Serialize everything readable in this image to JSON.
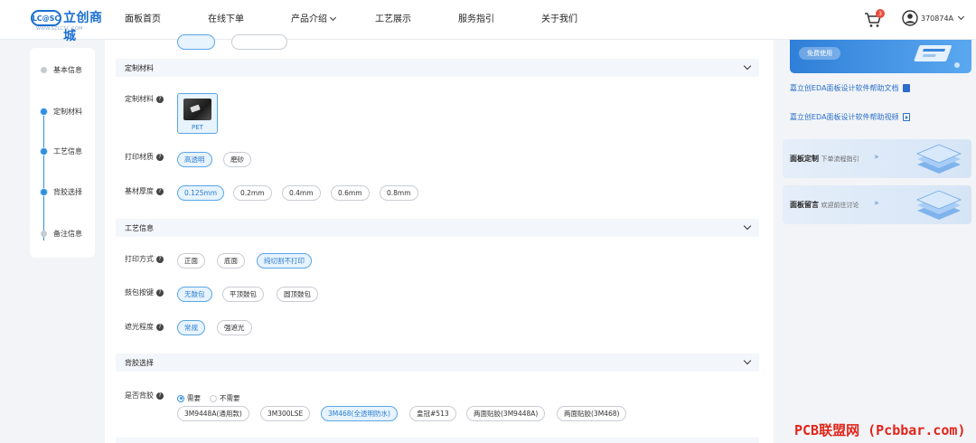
{
  "brand": {
    "badge": "LC@SC",
    "name": "立创商城",
    "url": "WWW.SZLCSC.COM"
  },
  "nav": [
    {
      "label": "面板首页"
    },
    {
      "label": "在线下单"
    },
    {
      "label": "产品介绍"
    },
    {
      "label": "工艺展示"
    },
    {
      "label": "服务指引"
    },
    {
      "label": "关于我们"
    }
  ],
  "cart": {
    "count": "3"
  },
  "user": {
    "name": "370874A"
  },
  "steps": [
    {
      "label": "基本信息",
      "active": false
    },
    {
      "label": "定制材料",
      "active": true
    },
    {
      "label": "工艺信息",
      "active": true
    },
    {
      "label": "背胶选择",
      "active": true
    },
    {
      "label": "备注信息",
      "active": false
    }
  ],
  "sections": {
    "material": {
      "title": "定制材料"
    },
    "process": {
      "title": "工艺信息"
    },
    "adhesive": {
      "title": "背胶选择"
    }
  },
  "fields": {
    "material": {
      "label": "定制材料",
      "option": "PET"
    },
    "print_finish": {
      "label": "打印材质",
      "options": [
        "高透明",
        "磨砂"
      ],
      "selected": 0
    },
    "thickness": {
      "label": "基材厚度",
      "options": [
        "0.125mm",
        "0.2mm",
        "0.4mm",
        "0.6mm",
        "0.8mm"
      ],
      "selected": 0
    },
    "print_mode": {
      "label": "打印方式",
      "options": [
        "正面",
        "底面",
        "纯切割不打印"
      ],
      "selected": 2
    },
    "emboss": {
      "label": "鼓包按键",
      "options": [
        "无鼓包",
        "平顶鼓包",
        "圆顶鼓包"
      ],
      "selected": 0
    },
    "shading": {
      "label": "遮光程度",
      "options": [
        "常规",
        "强遮光"
      ],
      "selected": 0
    },
    "need_adhesive": {
      "label": "是否背胶",
      "options": [
        "需要",
        "不需要"
      ],
      "selected": 0
    },
    "adhesive_type": {
      "options": [
        "3M9448A(通用款)",
        "3M300LSE",
        "3M468(全透明防水)",
        "皇冠#513",
        "两面贴胶(3M9448A)",
        "两面贴胶(3M468)"
      ],
      "selected": 2
    }
  },
  "sidebar": {
    "promo_button": "免费使用",
    "links": [
      {
        "label": "嘉立创EDA面板设计软件帮助文档"
      },
      {
        "label": "嘉立创EDA面板设计软件帮助视频"
      }
    ],
    "cards": [
      {
        "title": "面板定制",
        "subtitle": "下单流程指引",
        "arrow": "»"
      },
      {
        "title": "面板留言",
        "subtitle": "欢迎前往讨论",
        "arrow": "»"
      }
    ]
  },
  "watermark": "PCB联盟网 (Pcbbar.com)",
  "colors": {
    "accent": "#2f8fe0",
    "selected_bg": "#e7f3fd",
    "watermark": "#e1251b"
  }
}
